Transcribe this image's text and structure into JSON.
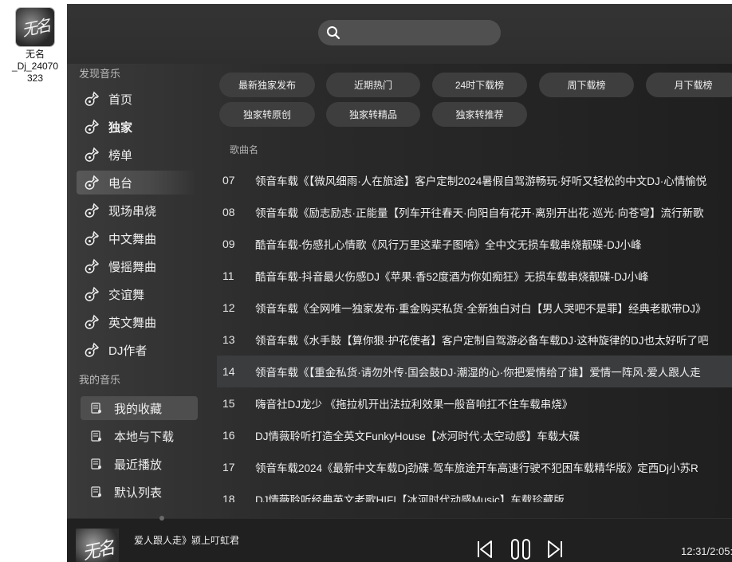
{
  "desktop_icon": {
    "label": "无名\n_Dj_24070\n323",
    "thumb_text": "无名"
  },
  "search": {
    "placeholder": ""
  },
  "sidebar": {
    "discover_title": "发现音乐",
    "discover_items": [
      {
        "label": "首页"
      },
      {
        "label": "独家"
      },
      {
        "label": "榜单"
      },
      {
        "label": "电台"
      },
      {
        "label": "现场串烧"
      },
      {
        "label": "中文舞曲"
      },
      {
        "label": "慢摇舞曲"
      },
      {
        "label": "交谊舞"
      },
      {
        "label": "英文舞曲"
      },
      {
        "label": "DJ作者"
      }
    ],
    "my_title": "我的音乐",
    "my_items": [
      {
        "label": "我的收藏"
      },
      {
        "label": "本地与下载"
      },
      {
        "label": "最近播放"
      },
      {
        "label": "默认列表"
      }
    ]
  },
  "tags": [
    "最新独家发布",
    "近期热门",
    "24时下载榜",
    "周下载榜",
    "月下载榜",
    "独家转原创",
    "独家转精品",
    "独家转推荐"
  ],
  "list": {
    "column_header": "歌曲名",
    "songs": [
      {
        "num": "07",
        "name": "领音车载《【微风细雨·人在旅途】客户定制2024暑假自驾游畅玩·好听又轻松的中文DJ·心情愉悦"
      },
      {
        "num": "08",
        "name": "领音车载《励志励志·正能量【列车开往春天·向阳自有花开·离别开出花·巡光·向苍穹】流行新歌"
      },
      {
        "num": "09",
        "name": "酷音车载-伤感扎心情歌《风行万里这辈子图啥》全中文无损车载串烧靓碟-DJ小峰"
      },
      {
        "num": "11",
        "name": "酷音车载-抖音最火伤感DJ《苹果·香52度酒为你如痴狂》无损车载串烧靓碟-DJ小峰"
      },
      {
        "num": "12",
        "name": "领音车载《全网唯一独家发布·重金购买私货·全新独白对白【男人哭吧不是罪】经典老歌带DJ》"
      },
      {
        "num": "13",
        "name": "领音车载《水手鼓【算你狠·护花使者】客户定制自驾游必备车载DJ·这种旋律的DJ也太好听了吧"
      },
      {
        "num": "14",
        "name": "领音车载《【重金私货·请勿外传·国会鼓DJ·潮湿的心·你把爱情给了谁】爱情一阵风·爱人跟人走"
      },
      {
        "num": "15",
        "name": "嗨音社DJ龙少 《拖拉机开出法拉利效果一般音响扛不住车载串烧》"
      },
      {
        "num": "16",
        "name": "DJ情薇聆听打造全英文FunkyHouse【冰河时代·太空动感】车载大碟"
      },
      {
        "num": "17",
        "name": "领音车载2024《最新中文车载Dj劲碟·驾车旅途开车高速行驶不犯困车载精华版》定西Dj小苏R"
      },
      {
        "num": "18",
        "name": "DJ情薇聆听经典英文老歌HIFI【冰河时代动感Music】车载珍藏版"
      }
    ]
  },
  "player": {
    "now_playing": "爱人跟人走》颍上叮虹君",
    "cover_text": "无名",
    "time": "12:31/2:05:"
  },
  "colors": {
    "bg": "#2a2a2a",
    "active_row": "#3a3c3e",
    "pill": "#3e3e3e"
  }
}
